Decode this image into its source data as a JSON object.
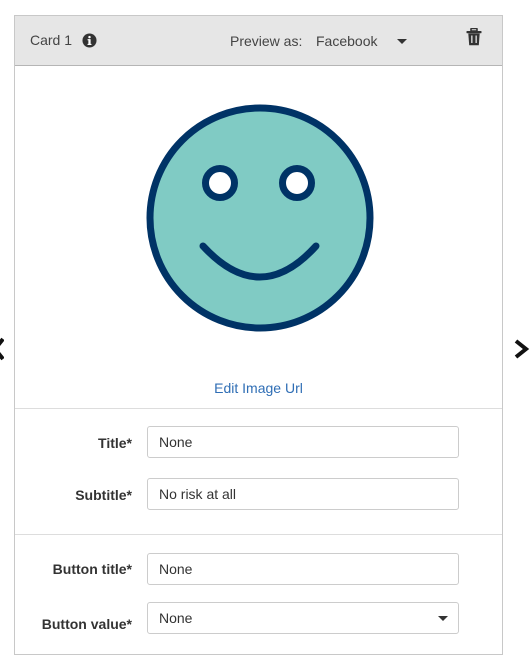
{
  "card": {
    "title": "Card 1",
    "info_icon": "info-circle-icon",
    "preview_label": "Preview as:",
    "preview_value": "Facebook",
    "delete_icon": "trash-icon"
  },
  "image": {
    "icon": "smiley-face-icon",
    "colors": {
      "face": "#80cbc4",
      "outline": "#003366",
      "eye_white": "#ffffff"
    },
    "edit_link": "Edit Image Url"
  },
  "fields": {
    "title": {
      "label": "Title*",
      "value": "None"
    },
    "subtitle": {
      "label": "Subtitle*",
      "value": "No risk at all"
    },
    "button_title": {
      "label": "Button title*",
      "value": "None"
    },
    "button_value": {
      "label": "Button value*",
      "value": "None"
    }
  },
  "navigation": {
    "prev_icon": "chevron-left-icon",
    "next_icon": "chevron-right-icon"
  },
  "colors": {
    "link": "#2f6eb5",
    "header_bg": "#e6e6e6",
    "border": "#c8c8c8"
  }
}
